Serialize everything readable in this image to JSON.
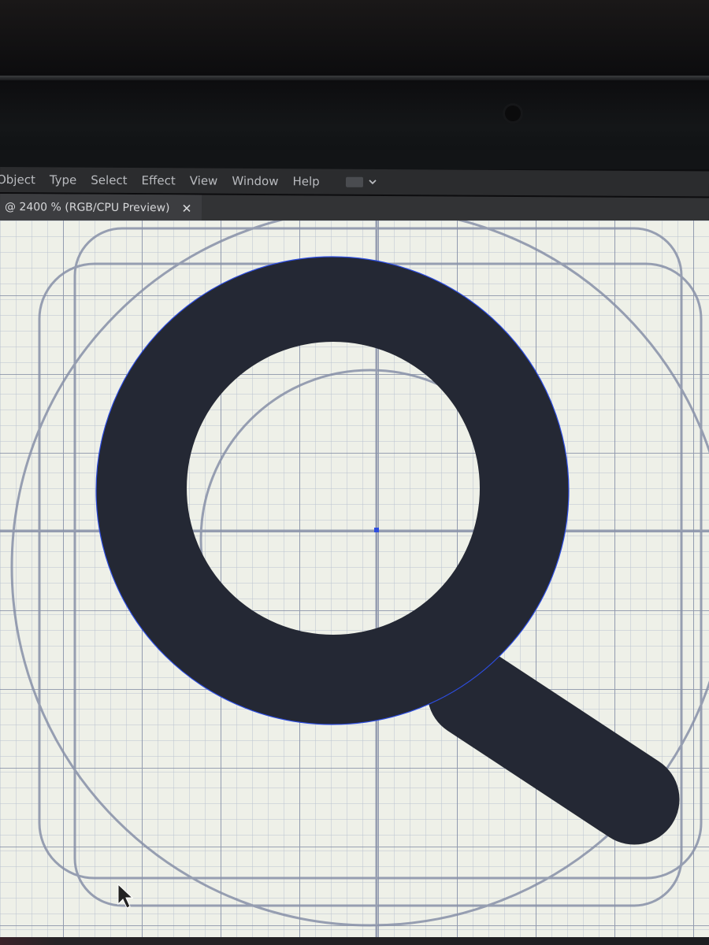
{
  "menubar": {
    "items": [
      "Object",
      "Type",
      "Select",
      "Effect",
      "View",
      "Window",
      "Help"
    ],
    "workspace_icon": "workspace-grid-icon",
    "chevron_icon": "chevron-down-icon"
  },
  "document_tab": {
    "title": "@ 2400 % (RGB/CPU Preview)",
    "close_icon": "close-icon"
  },
  "artboard": {
    "icon_shape": "magnifying-glass-icon",
    "fill_color": "#242834",
    "selection_color": "#2d4de0",
    "grid_color": "#9ea6b8",
    "background_color": "#eef0e8"
  },
  "cursor": {
    "icon": "arrow-cursor-icon"
  }
}
